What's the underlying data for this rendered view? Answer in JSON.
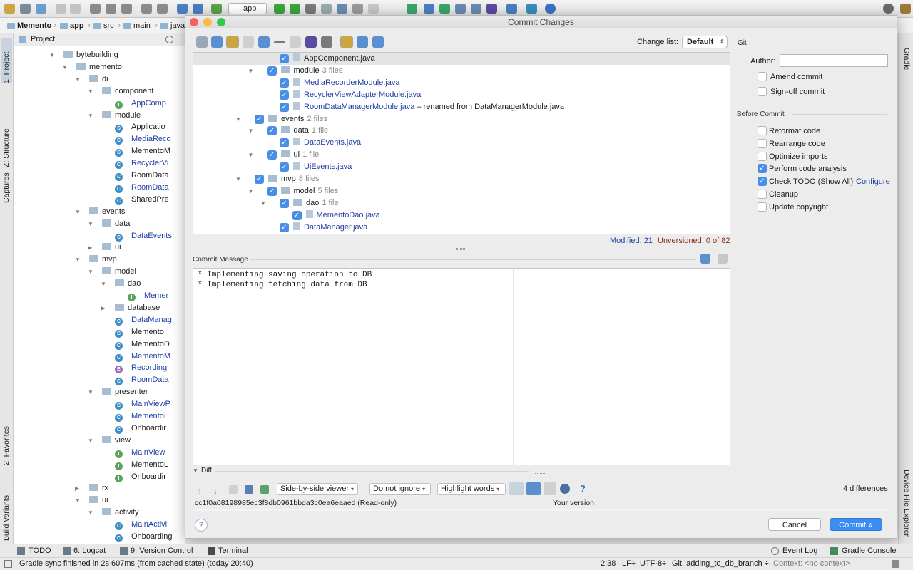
{
  "breadcrumb": [
    "Memento",
    "app",
    "src",
    "main",
    "java"
  ],
  "left_tabs": {
    "project": "1: Project",
    "structure": "Z: Structure",
    "captures": "Captures",
    "favorites": "2: Favorites",
    "build_variants": "Build Variants"
  },
  "right_tabs": {
    "gradle": "Gradle",
    "device_explorer": "Device File Explorer"
  },
  "toolbar": {
    "run_config": "app"
  },
  "project_panel": {
    "title": "Project",
    "rows": [
      {
        "label": "bytebuilding",
        "kind": "folder",
        "depth": 0,
        "arrow": "down"
      },
      {
        "label": "memento",
        "kind": "folder",
        "depth": 1,
        "arrow": "down"
      },
      {
        "label": "di",
        "kind": "folder",
        "depth": 2,
        "arrow": "down"
      },
      {
        "label": "component",
        "kind": "folder",
        "depth": 3,
        "arrow": "down"
      },
      {
        "label": "AppComp",
        "kind": "I",
        "depth": 4,
        "blue": true
      },
      {
        "label": "module",
        "kind": "folder",
        "depth": 3,
        "arrow": "down"
      },
      {
        "label": "Applicatio",
        "kind": "C",
        "depth": 4
      },
      {
        "label": "MediaReco",
        "kind": "C",
        "depth": 4,
        "blue": true
      },
      {
        "label": "MementoM",
        "kind": "C",
        "depth": 4
      },
      {
        "label": "RecyclerVi",
        "kind": "C",
        "depth": 4,
        "blue": true
      },
      {
        "label": "RoomData",
        "kind": "C",
        "depth": 4
      },
      {
        "label": "RoomData",
        "kind": "C",
        "depth": 4,
        "blue": true
      },
      {
        "label": "SharedPre",
        "kind": "C",
        "depth": 4
      },
      {
        "label": "events",
        "kind": "folder",
        "depth": 2,
        "arrow": "down"
      },
      {
        "label": "data",
        "kind": "folder",
        "depth": 3,
        "arrow": "down"
      },
      {
        "label": "DataEvents",
        "kind": "C",
        "depth": 4,
        "blue": true
      },
      {
        "label": "ui",
        "kind": "folder",
        "depth": 3,
        "arrow": "right"
      },
      {
        "label": "mvp",
        "kind": "folder",
        "depth": 2,
        "arrow": "down"
      },
      {
        "label": "model",
        "kind": "folder",
        "depth": 3,
        "arrow": "down"
      },
      {
        "label": "dao",
        "kind": "folder",
        "depth": 4,
        "arrow": "down"
      },
      {
        "label": "Memer",
        "kind": "I",
        "depth": 5,
        "blue": true
      },
      {
        "label": "database",
        "kind": "folder",
        "depth": 4,
        "arrow": "right"
      },
      {
        "label": "DataManag",
        "kind": "C",
        "depth": 4,
        "blue": true
      },
      {
        "label": "Memento",
        "kind": "C",
        "depth": 4
      },
      {
        "label": "MementoD",
        "kind": "C",
        "depth": 4
      },
      {
        "label": "MementoM",
        "kind": "C",
        "depth": 4,
        "blue": true
      },
      {
        "label": "Recording",
        "kind": "E",
        "depth": 4,
        "blue": true
      },
      {
        "label": "RoomData",
        "kind": "C",
        "depth": 4,
        "blue": true
      },
      {
        "label": "presenter",
        "kind": "folder",
        "depth": 3,
        "arrow": "down"
      },
      {
        "label": "MainViewP",
        "kind": "C",
        "depth": 4,
        "blue": true
      },
      {
        "label": "MementoL",
        "kind": "C",
        "depth": 4,
        "blue": true
      },
      {
        "label": "Onboardir",
        "kind": "C",
        "depth": 4
      },
      {
        "label": "view",
        "kind": "folder",
        "depth": 3,
        "arrow": "down"
      },
      {
        "label": "MainView",
        "kind": "I",
        "depth": 4,
        "blue": true
      },
      {
        "label": "MementoL",
        "kind": "I",
        "depth": 4
      },
      {
        "label": "Onboardir",
        "kind": "I",
        "depth": 4
      },
      {
        "label": "rx",
        "kind": "folder",
        "depth": 2,
        "arrow": "right"
      },
      {
        "label": "ui",
        "kind": "folder",
        "depth": 2,
        "arrow": "down"
      },
      {
        "label": "activity",
        "kind": "folder",
        "depth": 3,
        "arrow": "down"
      },
      {
        "label": "MainActivi",
        "kind": "C",
        "depth": 4,
        "blue": true
      },
      {
        "label": "Onboarding",
        "kind": "C",
        "depth": 4
      }
    ]
  },
  "dialog": {
    "title": "Commit Changes",
    "change_list_label": "Change list:",
    "change_list_value": "Default",
    "git_label": "Git",
    "files": [
      {
        "name": "AppComponent.java",
        "kind": "file",
        "depth": 3,
        "selected": true
      },
      {
        "name": "module",
        "count": "3 files",
        "kind": "folder",
        "depth": 2
      },
      {
        "name": "MediaRecorderModule.java",
        "kind": "file",
        "depth": 3,
        "blue": true
      },
      {
        "name": "RecyclerViewAdapterModule.java",
        "kind": "file",
        "depth": 3,
        "blue": true
      },
      {
        "name": "RoomDataManagerModule.java",
        "kind": "file",
        "depth": 3,
        "blue": true,
        "note": " – renamed from DataManagerModule.java"
      },
      {
        "name": "events",
        "count": "2 files",
        "kind": "folder",
        "depth": 1
      },
      {
        "name": "data",
        "count": "1 file",
        "kind": "folder",
        "depth": 2
      },
      {
        "name": "DataEvents.java",
        "kind": "file",
        "depth": 3,
        "blue": true
      },
      {
        "name": "ui",
        "count": "1 file",
        "kind": "folder",
        "depth": 2
      },
      {
        "name": "UiEvents.java",
        "kind": "file",
        "depth": 3,
        "blue": true
      },
      {
        "name": "mvp",
        "count": "8 files",
        "kind": "folder",
        "depth": 1
      },
      {
        "name": "model",
        "count": "5 files",
        "kind": "folder",
        "depth": 2
      },
      {
        "name": "dao",
        "count": "1 file",
        "kind": "folder",
        "depth": 3
      },
      {
        "name": "MementoDao.java",
        "kind": "file",
        "depth": 4,
        "blue": true
      },
      {
        "name": "DataManager.java",
        "kind": "file",
        "depth": 3,
        "blue": true
      }
    ],
    "modified": "Modified: 21",
    "unversioned": "Unversioned: 0 of 82",
    "commit_message_label": "Commit Message",
    "commit_message": [
      "* Implementing saving operation to DB",
      "* Implementing fetching data from DB"
    ],
    "author_label": "Author:",
    "author_value": "",
    "amend_commit": "Amend commit",
    "signoff_commit": "Sign-off commit",
    "before_commit_label": "Before Commit",
    "before_commit": [
      {
        "label": "Reformat code",
        "checked": false
      },
      {
        "label": "Rearrange code",
        "checked": false
      },
      {
        "label": "Optimize imports",
        "checked": false
      },
      {
        "label": "Perform code analysis",
        "checked": true
      },
      {
        "label": "Check TODO (Show All)",
        "checked": true
      },
      {
        "label": "Cleanup",
        "checked": false
      },
      {
        "label": "Update copyright",
        "checked": false
      }
    ],
    "configure_link": "Configure",
    "diff_label": "Diff",
    "viewer_select": "Side-by-side viewer",
    "ignore_select": "Do not ignore",
    "highlight_select": "Highlight words",
    "differences": "4 differences",
    "left_revision": "cc1f0a08198985ec3f8db0961bbda3c0ea6eaaed (Read-only)",
    "right_revision": "Your version",
    "cancel": "Cancel",
    "commit": "Commit"
  },
  "bottom_tabs": [
    "TODO",
    "6: Logcat",
    "9: Version Control",
    "Terminal"
  ],
  "bottom_right_tabs": [
    "Event Log",
    "Gradle Console"
  ],
  "status": {
    "message": "Gradle sync finished in 2s 607ms (from cached state) (today 20:40)",
    "position": "2:38",
    "line_sep": "LF÷",
    "encoding": "UTF-8÷",
    "branch": "Git: adding_to_db_branch ÷",
    "context": "Context: <no context>"
  },
  "colors": {
    "checkbox": "#4a8fe6",
    "link_blue": "#1f3fa8",
    "unversioned": "#8a2a12",
    "commit_button": "#3b8df0"
  }
}
